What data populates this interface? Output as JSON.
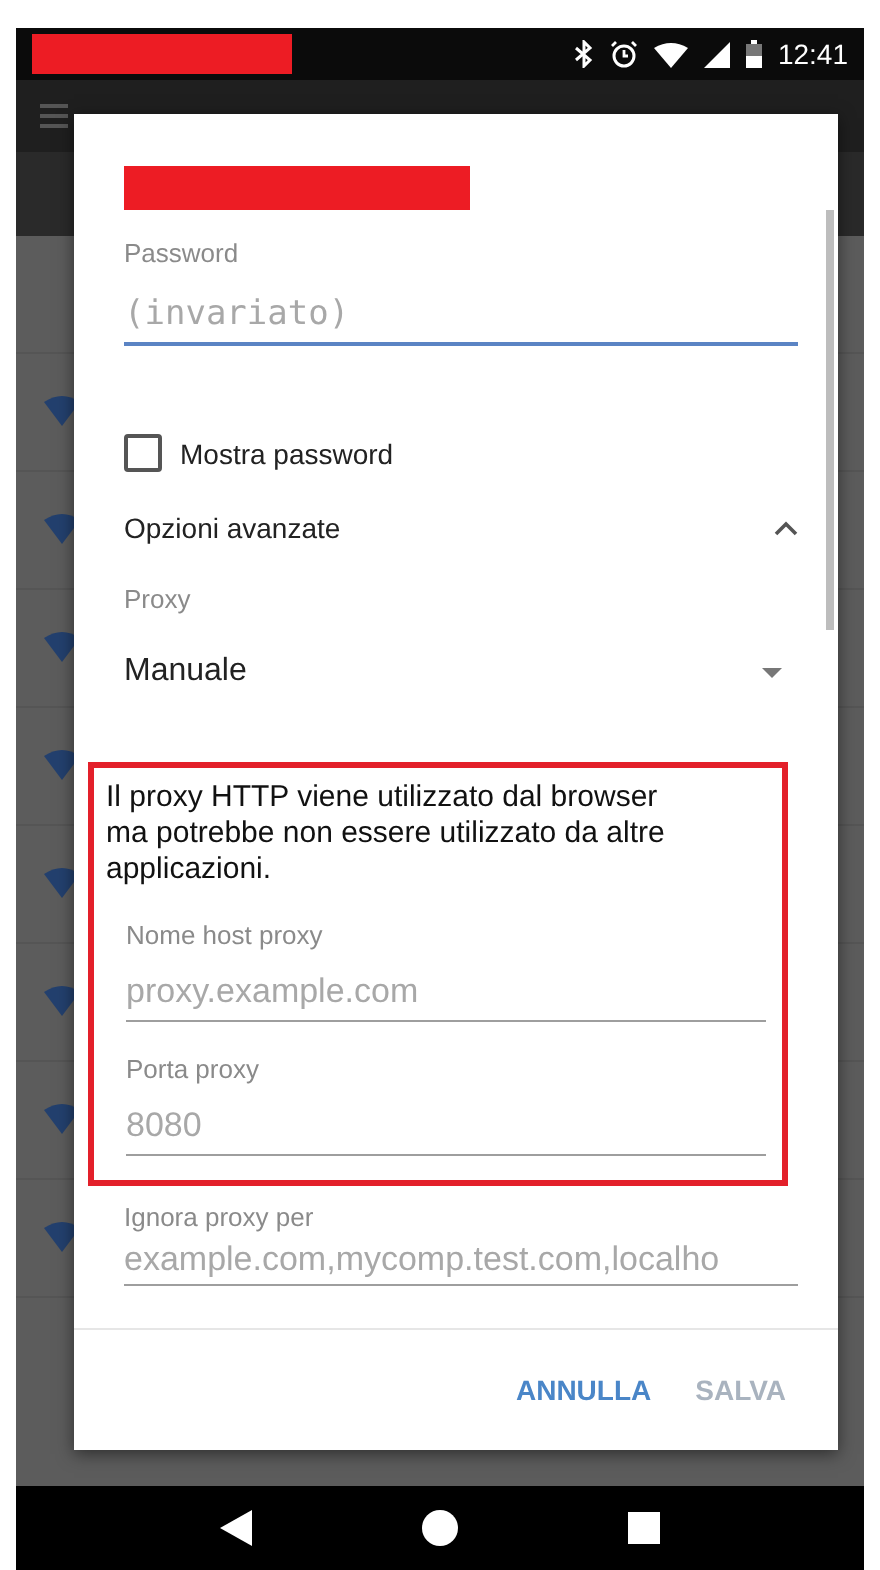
{
  "status_bar": {
    "time": "12:41"
  },
  "dialog": {
    "password": {
      "label": "Password",
      "placeholder": "(invariato)",
      "focused": true
    },
    "show_password": {
      "label": "Mostra password",
      "checked": false
    },
    "advanced": {
      "label": "Opzioni avanzate",
      "expanded": true
    },
    "proxy": {
      "label": "Proxy",
      "value": "Manuale"
    },
    "highlight": {
      "note": "Il proxy HTTP viene utilizzato dal browser ma potrebbe non essere utilizzato da altre applicazioni.",
      "fields": [
        {
          "label": "Nome host proxy",
          "placeholder": "proxy.example.com"
        },
        {
          "label": "Porta proxy",
          "placeholder": "8080"
        }
      ]
    },
    "bypass": {
      "label": "Ignora proxy per",
      "placeholder": "example.com,mycomp.test.com,localho"
    },
    "buttons": [
      {
        "label": "ANNULLA",
        "disabled": false
      },
      {
        "label": "SALVA",
        "disabled": true
      }
    ]
  }
}
